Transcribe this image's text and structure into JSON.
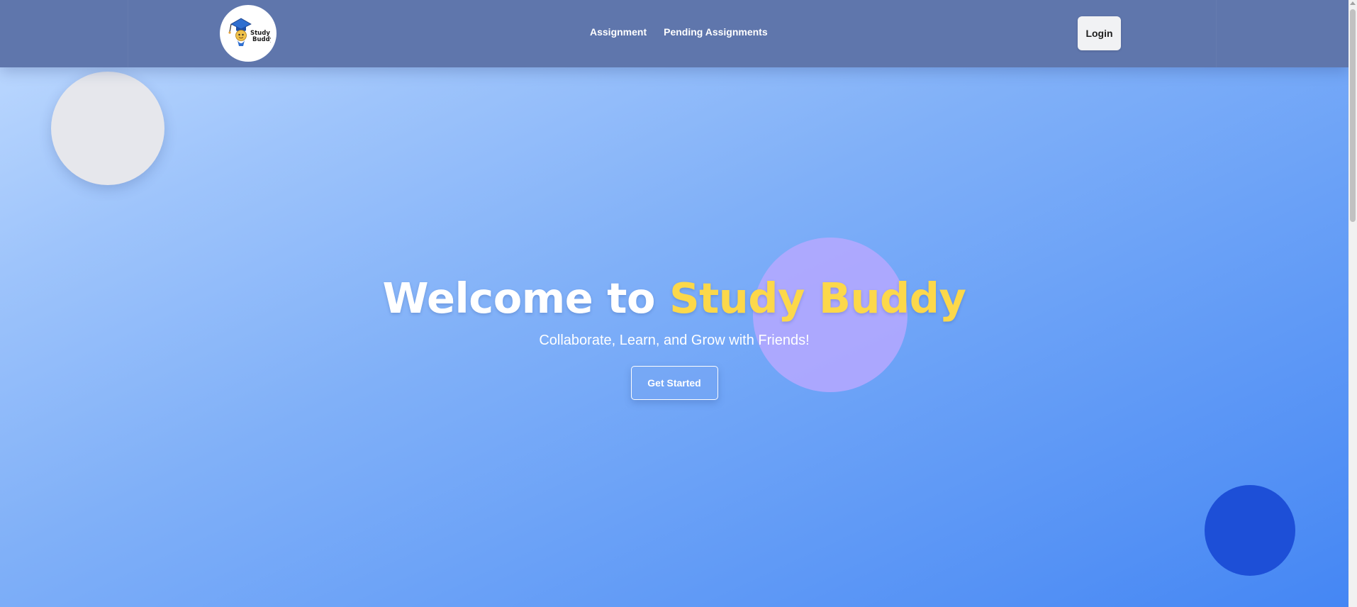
{
  "brand": {
    "logo_text_line1": "Study",
    "logo_text_line2": "Buddy",
    "logo_icon": "graduation-cap-mascot"
  },
  "nav": {
    "items": [
      {
        "label": "Assignment"
      },
      {
        "label": "Pending Assignments"
      }
    ],
    "login_label": "Login"
  },
  "hero": {
    "title_prefix": "Welcome to ",
    "title_highlight": "Study Buddy",
    "subtitle": "Collaborate, Learn, and Grow with Friends!",
    "cta_label": "Get Started"
  },
  "colors": {
    "navbar": "#5f76ac",
    "accent_yellow": "#fcd84a",
    "circle_gray": "#e6e7ec",
    "circle_purple": "#b6a8ff",
    "circle_blue": "#1d4fd7",
    "gradient_start": "#c2dcff",
    "gradient_end": "#4486f4"
  }
}
